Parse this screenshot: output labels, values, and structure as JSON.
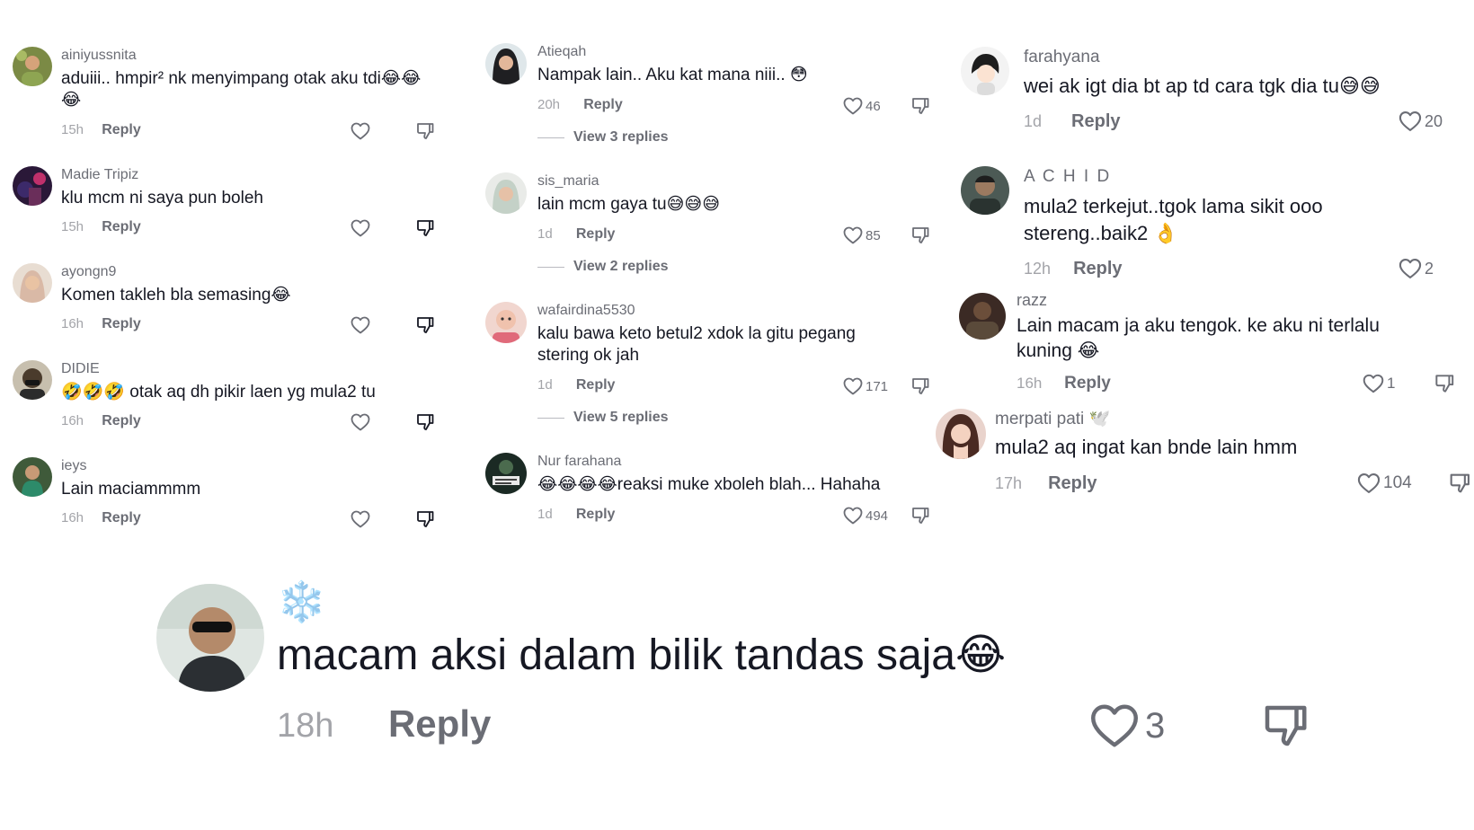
{
  "columns": [
    {
      "comments": [
        {
          "username": "ainiyussnita",
          "text": "aduiii.. hmpir² nk menyimpang otak aku tdi😂😂😂",
          "time": "15h",
          "reply": "Reply",
          "likes": ""
        },
        {
          "username": "Madie Tripiz",
          "text": "klu mcm ni saya pun boleh",
          "time": "15h",
          "reply": "Reply",
          "likes": ""
        },
        {
          "username": "ayongn9",
          "text": "Komen takleh bla semasing😂",
          "time": "16h",
          "reply": "Reply",
          "likes": ""
        },
        {
          "username": "DIDIE",
          "text": "🤣🤣🤣 otak aq dh pikir laen yg mula2 tu",
          "time": "16h",
          "reply": "Reply",
          "likes": ""
        },
        {
          "username": "ieys",
          "text": "Lain maciammmm",
          "time": "16h",
          "reply": "Reply",
          "likes": ""
        }
      ]
    },
    {
      "comments": [
        {
          "username": "Atieqah",
          "text": "Nampak lain.. Aku kat mana niii.. 😳",
          "time": "20h",
          "reply": "Reply",
          "likes": "46",
          "view_replies": "View 3 replies"
        },
        {
          "username": "sis_maria",
          "text": "lain mcm gaya tu😅😅😅",
          "time": "1d",
          "reply": "Reply",
          "likes": "85",
          "view_replies": "View 2 replies"
        },
        {
          "username": "wafairdina5530",
          "text": "kalu bawa keto betul2 xdok la gitu pegang stering ok jah",
          "time": "1d",
          "reply": "Reply",
          "likes": "171",
          "view_replies": "View 5 replies"
        },
        {
          "username": "Nur farahana",
          "text": "😂😂😂😂reaksi muke xboleh blah... Hahaha",
          "time": "1d",
          "reply": "Reply",
          "likes": "494"
        }
      ]
    },
    {
      "comments": [
        {
          "username": "farahyana",
          "text": "wei ak igt dia bt ap td cara tgk dia tu😅😅",
          "time": "1d",
          "reply": "Reply",
          "likes": "20"
        },
        {
          "username": "A C H I D",
          "text": "mula2 terkejut..tgok lama sikit ooo stereng..baik2 👌",
          "time": "12h",
          "reply": "Reply",
          "likes": "2"
        },
        {
          "username": "razz",
          "text": "Lain macam ja aku tengok. ke aku ni terlalu kuning 😂",
          "time": "16h",
          "reply": "Reply",
          "likes": "1"
        },
        {
          "username": "merpati pati 🕊️",
          "text": "mula2 aq ingat kan bnde lain hmm",
          "time": "17h",
          "reply": "Reply",
          "likes": "104"
        }
      ]
    }
  ],
  "featured": {
    "badge": "❄️",
    "text": "macam aksi dalam bilik tandas saja😂",
    "time": "18h",
    "reply": "Reply",
    "likes": "3"
  },
  "colors": {
    "text": "#161823",
    "username": "#6b6d75",
    "muted": "#a3a4a9"
  }
}
